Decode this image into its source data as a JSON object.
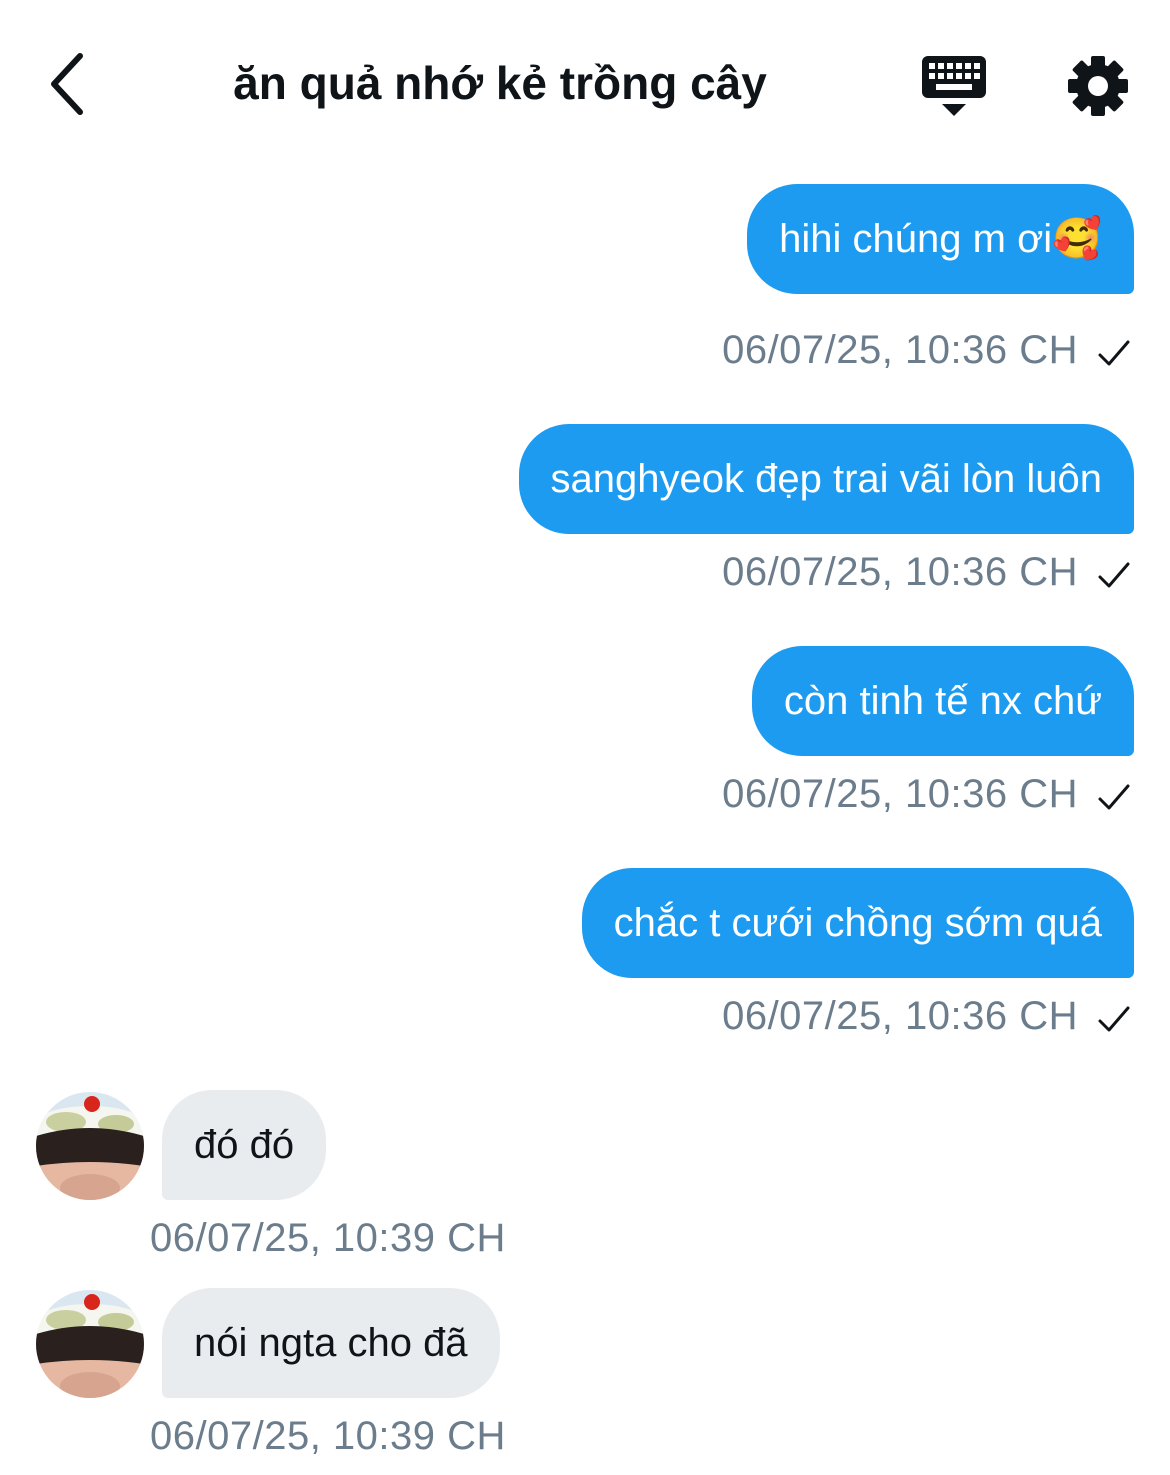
{
  "header": {
    "title": "ăn quả nhớ kẻ trồng cây",
    "back_icon": "chevron-left-icon",
    "keyboard_icon": "keyboard-icon",
    "settings_icon": "gear-icon"
  },
  "colors": {
    "outgoing_bubble": "#1d9bf0",
    "incoming_bubble": "#e9ecef",
    "timestamp": "#6b7d8c"
  },
  "messages": [
    {
      "direction": "outgoing",
      "text": "hihi chúng m ơi🥰",
      "time": "06/07/25, 10:36 CH",
      "status": "sent"
    },
    {
      "direction": "outgoing",
      "text": "sanghyeok đẹp trai vãi lòn luôn",
      "time": "06/07/25, 10:36 CH",
      "status": "sent"
    },
    {
      "direction": "outgoing",
      "text": "còn tinh tế nx chứ",
      "time": "06/07/25, 10:36 CH",
      "status": "sent"
    },
    {
      "direction": "outgoing",
      "text": "chắc t cưới chồng sớm quá",
      "time": "06/07/25, 10:36 CH",
      "status": "sent"
    },
    {
      "direction": "incoming",
      "text": "đó đó",
      "time": "06/07/25, 10:39 CH"
    },
    {
      "direction": "incoming",
      "text": "nói ngta cho đã",
      "time": "06/07/25, 10:39 CH"
    }
  ]
}
